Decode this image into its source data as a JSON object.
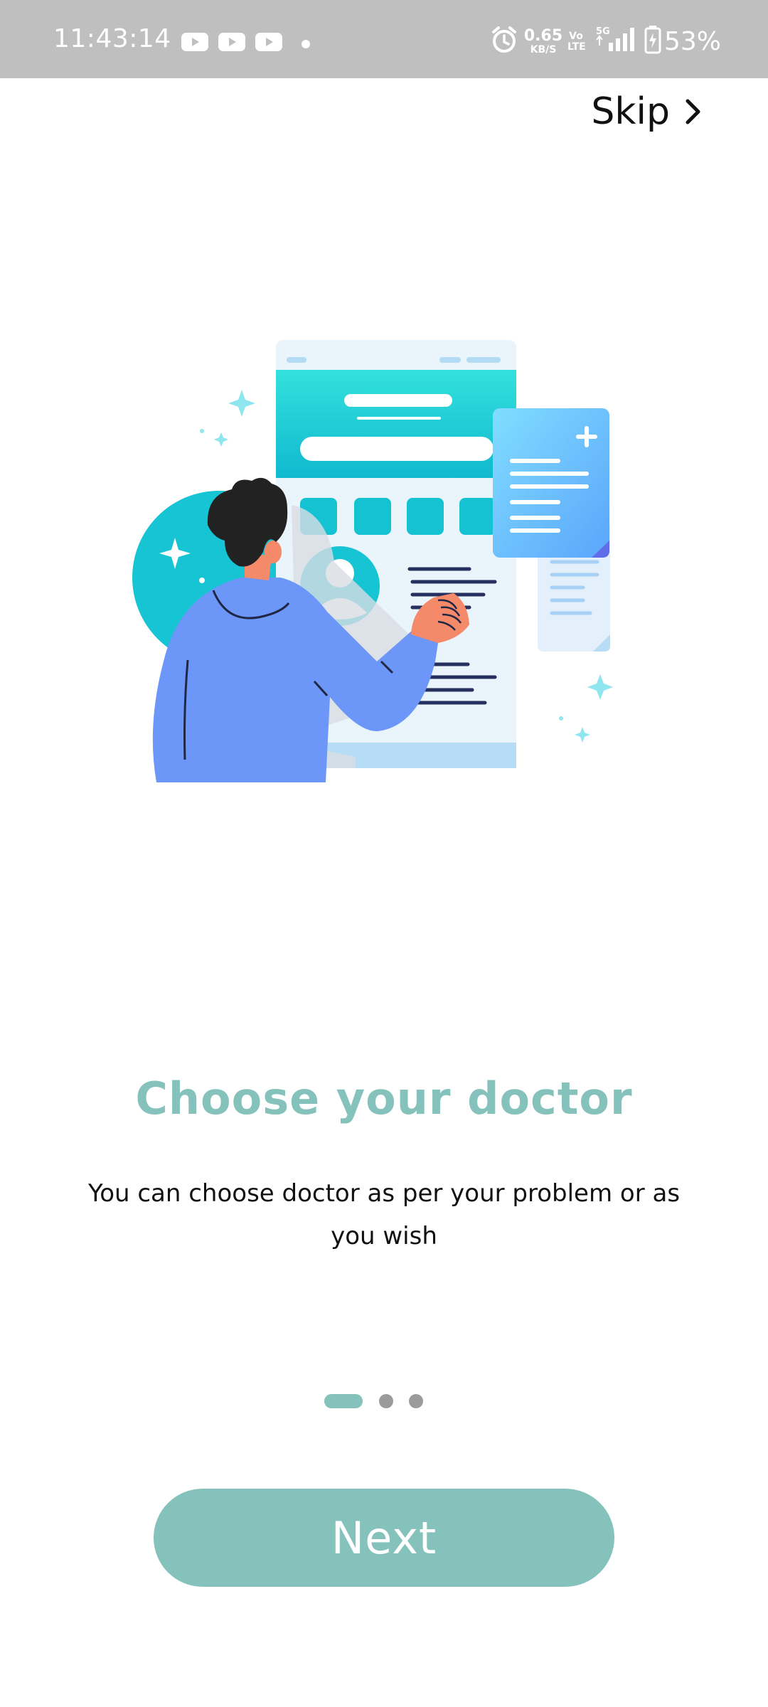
{
  "status_bar": {
    "time": "11:43:14",
    "net_speed_value": "0.65",
    "net_speed_unit": "KB/S",
    "volte_top": "Vo",
    "volte_bottom": "LTE",
    "network": "5G",
    "battery": "53%",
    "icons": [
      "youtube-icon",
      "youtube-icon",
      "youtube-icon",
      "notification-dot",
      "alarm-icon",
      "signal-icon",
      "battery-charging-icon"
    ]
  },
  "header": {
    "skip_label": "Skip",
    "skip_icon": "chevron-right-icon"
  },
  "onboarding": {
    "title": "Choose your doctor",
    "description": "You can choose doctor as per your problem or as you wish",
    "page_count": 3,
    "active_page": 1
  },
  "actions": {
    "next_label": "Next"
  },
  "colors": {
    "accent": "#84c2bb",
    "status_bar": "#bfbfbf",
    "dot_inactive": "#9b9b9b",
    "illustration_teal": "#1fc5d2",
    "illustration_blue": "#6b93f7"
  }
}
